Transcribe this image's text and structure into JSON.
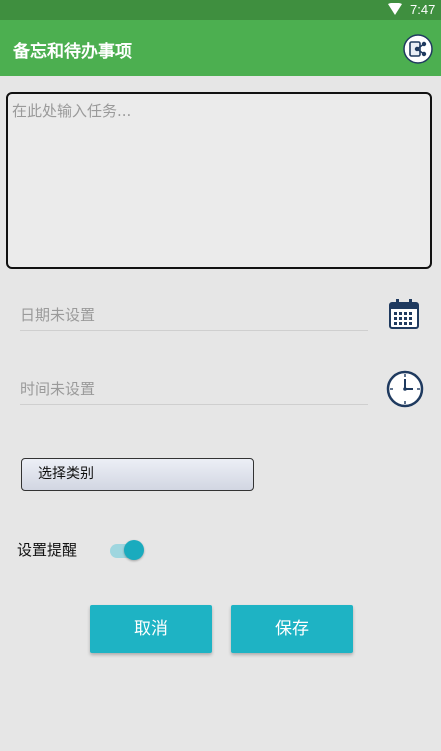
{
  "status_bar": {
    "time": "7:47"
  },
  "app_bar": {
    "title": "备忘和待办事项",
    "share_icon": "share-icon"
  },
  "task_input": {
    "placeholder": "在此处输入任务...",
    "value": ""
  },
  "date_field": {
    "text": "日期未设置",
    "icon": "calendar-icon"
  },
  "time_field": {
    "text": "时间未设置",
    "icon": "clock-icon"
  },
  "category": {
    "label": "选择类别"
  },
  "reminder": {
    "label": "设置提醒",
    "enabled": true
  },
  "actions": {
    "cancel_label": "取消",
    "save_label": "保存"
  },
  "colors": {
    "status_bar": "#3f8f3f",
    "app_bar": "#4caf50",
    "accent": "#1eb3c4",
    "background": "#e6e6e6",
    "icon": "#1f3a5f"
  }
}
